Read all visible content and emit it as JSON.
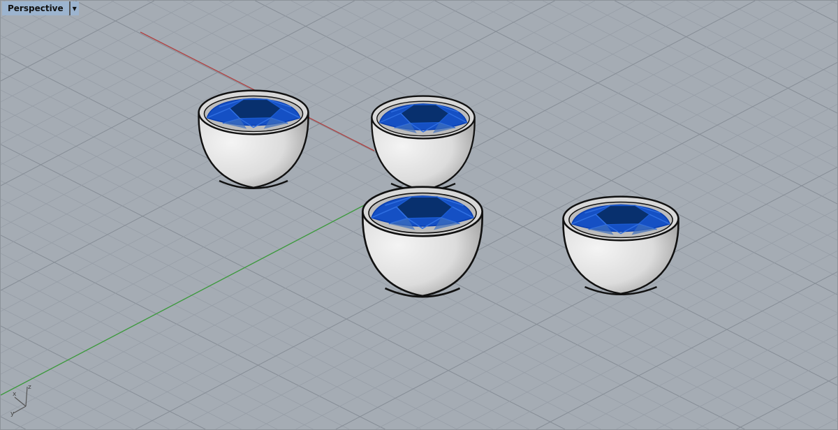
{
  "viewport": {
    "title": "Perspective",
    "menu_icon": "triangle-down-icon",
    "axis_labels": {
      "z": "z",
      "x": "x",
      "y": "y"
    }
  },
  "colors": {
    "background": "#a5acb4",
    "grid_minor": "#979ea7",
    "grid_major": "#868d96",
    "x_axis": "#b04040",
    "y_axis": "#3c9a3c",
    "cup_body": "#e4e4e4",
    "gem": "#0b3fa8",
    "gem_dark": "#06306f"
  }
}
